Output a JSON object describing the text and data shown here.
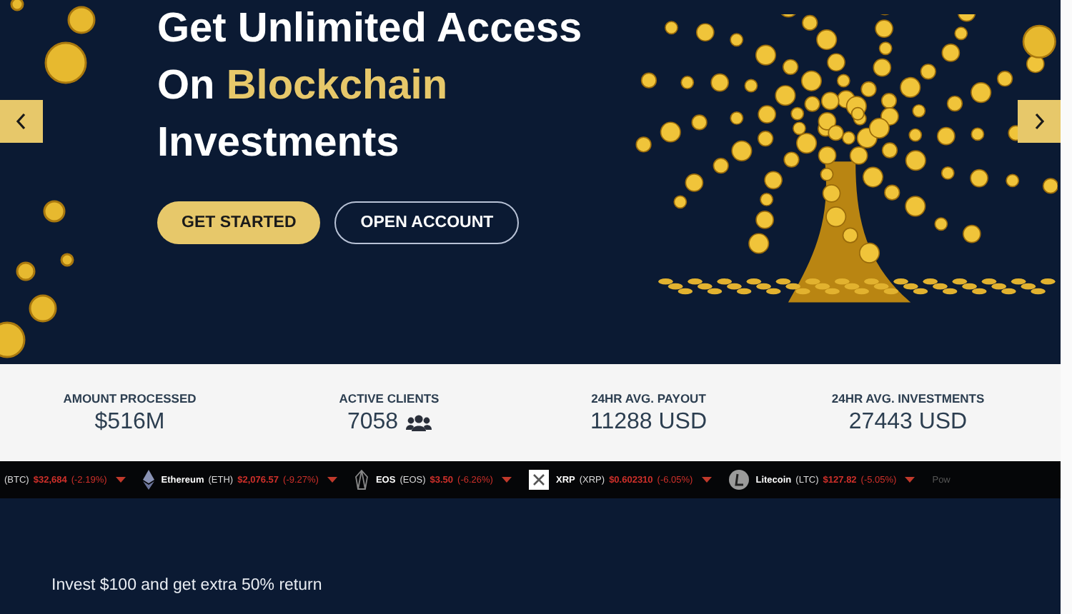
{
  "hero": {
    "headline": [
      [
        {
          "text": "Get Unlimited Access",
          "accent": false
        }
      ],
      [
        {
          "text": "On ",
          "accent": false
        },
        {
          "text": "Blockchain",
          "accent": true
        }
      ],
      [
        {
          "text": "Investments",
          "accent": false
        }
      ]
    ],
    "buttons": [
      {
        "label": "GET STARTED",
        "kind": "primary"
      },
      {
        "label": "OPEN ACCOUNT",
        "kind": "outline"
      }
    ]
  },
  "stats": [
    {
      "label": "AMOUNT PROCESSED",
      "value": "$516M",
      "kind": "plain"
    },
    {
      "label": "ACTIVE CLIENTS",
      "value": "7058",
      "kind": "people"
    },
    {
      "label": "24HR AVG. PAYOUT",
      "value": "11288 USD",
      "kind": "plain"
    },
    {
      "label": "24HR AVG. INVESTMENTS",
      "value": "27443 USD",
      "kind": "plain"
    }
  ],
  "ticker": {
    "items": [
      {
        "kind": "none",
        "symbol": "(BTC)",
        "price": "$32,684",
        "change": "(-2.19%)"
      },
      {
        "kind": "ethereum",
        "name": "Ethereum",
        "symbol": "(ETH)",
        "price": "$2,076.57",
        "change": "(-9.27%)"
      },
      {
        "kind": "eos",
        "name": "EOS",
        "symbol": "(EOS)",
        "price": "$3.50",
        "change": "(-6.26%)"
      },
      {
        "kind": "xrp",
        "name": "XRP",
        "symbol": "(XRP)",
        "price": "$0.602310",
        "change": "(-6.05%)"
      },
      {
        "kind": "litecoin",
        "name": "Litecoin",
        "symbol": "(LTC)",
        "price": "$127.82",
        "change": "(-5.05%)"
      }
    ],
    "credit": "Pow"
  },
  "promo": {
    "text": "Invest $100 and get extra 50% return"
  }
}
